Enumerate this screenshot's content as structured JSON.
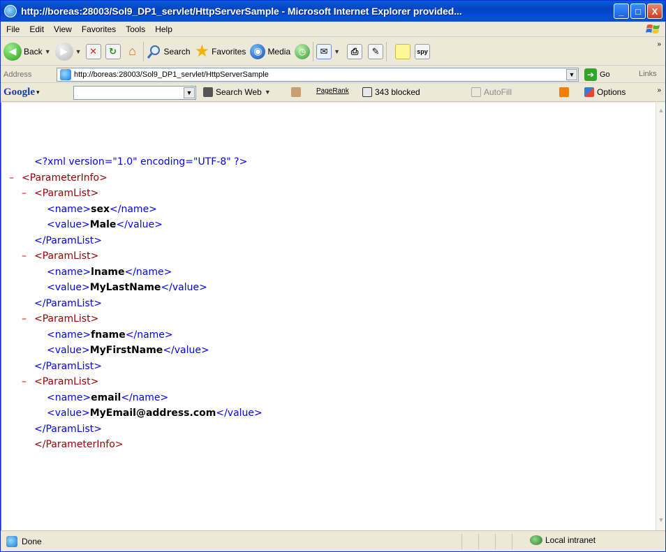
{
  "window": {
    "title": "http://boreas:28003/Sol9_DP1_servlet/HttpServerSample - Microsoft Internet Explorer provided...",
    "controls": {
      "minimize": "_",
      "maximize": "□",
      "close": "X"
    }
  },
  "menubar": {
    "items": [
      "File",
      "Edit",
      "View",
      "Favorites",
      "Tools",
      "Help"
    ]
  },
  "toolbar": {
    "back_label": "Back",
    "search_label": "Search",
    "favorites_label": "Favorites",
    "media_label": "Media"
  },
  "address": {
    "label": "Address",
    "url": "http://boreas:28003/Sol9_DP1_servlet/HttpServerSample",
    "go_label": "Go",
    "links_label": "Links"
  },
  "googlebar": {
    "logo": "Google",
    "search_value": "",
    "search_web_label": "Search Web",
    "pagerank_label": "PageRank",
    "blocked_label": "343 blocked",
    "autofill_label": "AutoFill",
    "options_label": "Options"
  },
  "xml": {
    "declaration": "<?xml version=\"1.0\" encoding=\"UTF-8\" ?>",
    "root_open": "<ParameterInfo>",
    "root_close": "</ParameterInfo>",
    "list_open": "<ParamList>",
    "list_close": "</ParamList>",
    "name_open": "<name>",
    "name_close": "</name>",
    "value_open": "<value>",
    "value_close": "</value>",
    "params": [
      {
        "name": "sex",
        "value": "Male"
      },
      {
        "name": "lname",
        "value": "MyLastName"
      },
      {
        "name": "fname",
        "value": "MyFirstName"
      },
      {
        "name": "email",
        "value": "MyEmail@address.com"
      }
    ],
    "collapse_marker": "–"
  },
  "status": {
    "text": "Done",
    "zone": "Local intranet"
  }
}
